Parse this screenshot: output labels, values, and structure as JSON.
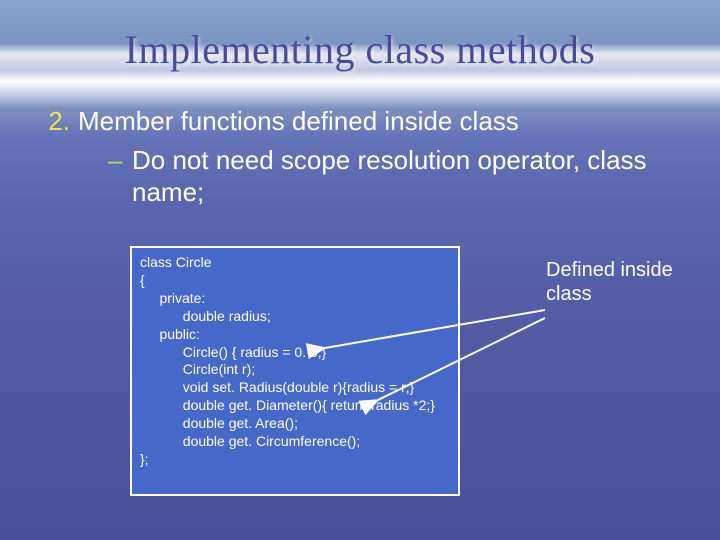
{
  "title": "Implementing class methods",
  "list": {
    "num": "2.",
    "text": "Member functions defined inside class",
    "sub_dash": "–",
    "sub_text": "Do not need scope resolution operator, class name;"
  },
  "code": "class Circle\n{\n     private:\n           double radius;\n     public:\n           Circle() { radius = 0. 0;}\n           Circle(int r);\n           void set. Radius(double r){radius = r;}\n           double get. Diameter(){ return radius *2;}\n           double get. Area();\n           double get. Circumference();\n};",
  "annotation": "Defined inside class"
}
